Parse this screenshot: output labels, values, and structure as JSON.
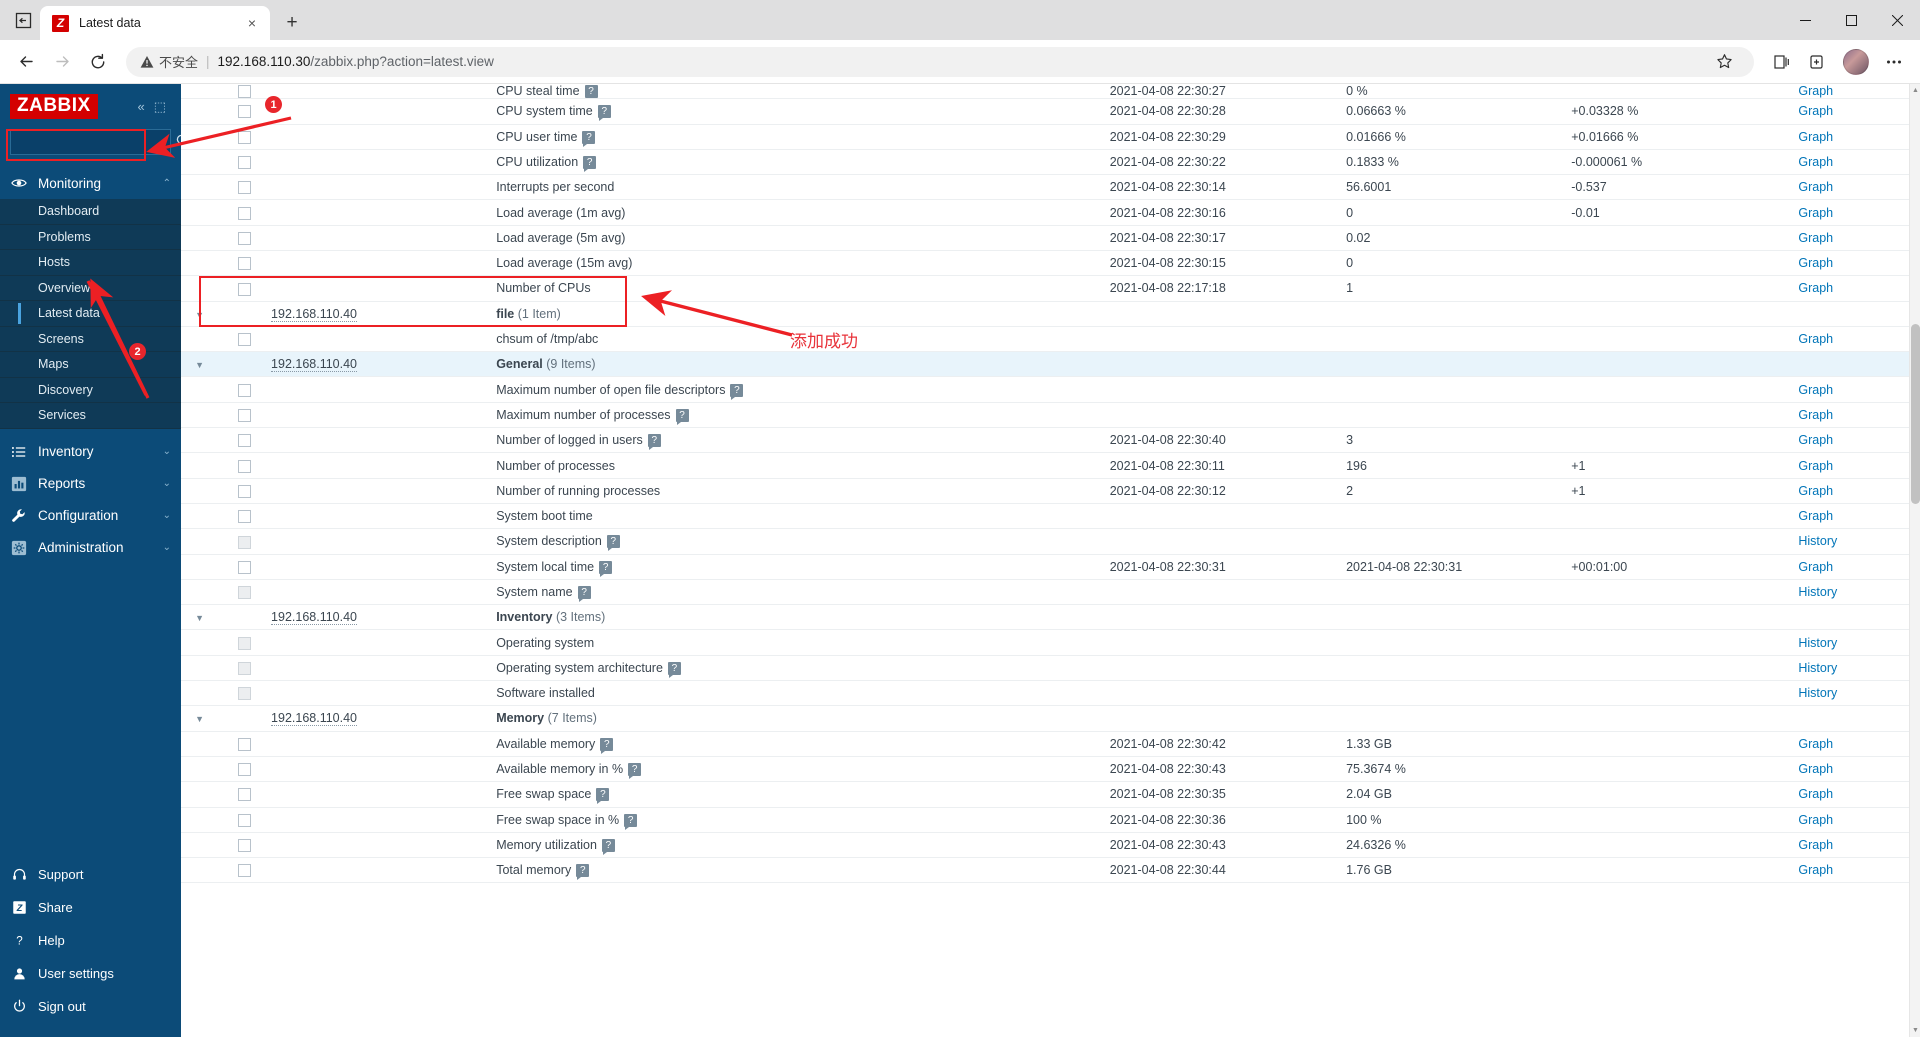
{
  "browser": {
    "tab": {
      "title": "Latest data",
      "favicon_letter": "Z",
      "close_label": "×"
    },
    "new_tab_label": "+",
    "window_controls": {
      "minimize": "─",
      "maximize": "⬜",
      "close": "✕"
    },
    "nav": {
      "back": "←",
      "forward": "→",
      "reload": "⟳"
    },
    "omnibox": {
      "warning_icon": "warning-triangle-icon",
      "security_label": "不安全",
      "separator": "|",
      "url_host": "192.168.110.30",
      "url_path": "/zabbix.php?action=latest.view",
      "full_url": "192.168.110.30/zabbix.php?action=latest.view"
    },
    "toolbar_icons": [
      "favorite-star-icon",
      "collections-icon",
      "browser-essentials-icon",
      "profile-avatar",
      "settings-more-icon"
    ]
  },
  "sidebar": {
    "logo": "ZABBIX",
    "collapse_icon": "«",
    "hide_icon": "⬚",
    "search": {
      "value": "",
      "placeholder": ""
    },
    "sections": [
      {
        "label": "Monitoring",
        "icon": "eye-icon",
        "expanded": true,
        "chevron": "⌃",
        "items": [
          {
            "label": "Dashboard",
            "selected": false
          },
          {
            "label": "Problems",
            "selected": false
          },
          {
            "label": "Hosts",
            "selected": false
          },
          {
            "label": "Overview",
            "selected": false
          },
          {
            "label": "Latest data",
            "selected": true
          },
          {
            "label": "Screens",
            "selected": false
          },
          {
            "label": "Maps",
            "selected": false
          },
          {
            "label": "Discovery",
            "selected": false
          },
          {
            "label": "Services",
            "selected": false
          }
        ]
      },
      {
        "label": "Inventory",
        "icon": "list-icon",
        "expanded": false,
        "chevron": "⌄",
        "items": []
      },
      {
        "label": "Reports",
        "icon": "bar-chart-icon",
        "expanded": false,
        "chevron": "⌄",
        "items": []
      },
      {
        "label": "Configuration",
        "icon": "wrench-icon",
        "expanded": false,
        "chevron": "⌄",
        "items": []
      },
      {
        "label": "Administration",
        "icon": "gear-icon",
        "expanded": false,
        "chevron": "⌄",
        "items": []
      }
    ],
    "bottom": [
      {
        "label": "Support",
        "icon": "headset-icon"
      },
      {
        "label": "Share",
        "icon": "zabbix-share-icon"
      },
      {
        "label": "Help",
        "icon": "question-icon"
      },
      {
        "label": "User settings",
        "icon": "user-icon"
      },
      {
        "label": "Sign out",
        "icon": "power-icon"
      }
    ]
  },
  "table": {
    "graph_label": "Graph",
    "history_label": "History",
    "rows": [
      {
        "kind": "item",
        "name": "CPU steal time",
        "info": true,
        "time": "2021-04-08 22:30:27",
        "value": "0 %",
        "change": "",
        "link": "Graph",
        "clipped": true
      },
      {
        "kind": "item",
        "name": "CPU system time",
        "info": true,
        "time": "2021-04-08 22:30:28",
        "value": "0.06663 %",
        "change": "+0.03328 %",
        "link": "Graph"
      },
      {
        "kind": "item",
        "name": "CPU user time",
        "info": true,
        "time": "2021-04-08 22:30:29",
        "value": "0.01666 %",
        "change": "+0.01666 %",
        "link": "Graph"
      },
      {
        "kind": "item",
        "name": "CPU utilization",
        "info": true,
        "time": "2021-04-08 22:30:22",
        "value": "0.1833 %",
        "change": "-0.000061 %",
        "link": "Graph"
      },
      {
        "kind": "item",
        "name": "Interrupts per second",
        "info": false,
        "time": "2021-04-08 22:30:14",
        "value": "56.6001",
        "change": "-0.537",
        "link": "Graph"
      },
      {
        "kind": "item",
        "name": "Load average (1m avg)",
        "info": false,
        "time": "2021-04-08 22:30:16",
        "value": "0",
        "change": "-0.01",
        "link": "Graph"
      },
      {
        "kind": "item",
        "name": "Load average (5m avg)",
        "info": false,
        "time": "2021-04-08 22:30:17",
        "value": "0.02",
        "change": "",
        "link": "Graph"
      },
      {
        "kind": "item",
        "name": "Load average (15m avg)",
        "info": false,
        "time": "2021-04-08 22:30:15",
        "value": "0",
        "change": "",
        "link": "Graph"
      },
      {
        "kind": "item",
        "name": "Number of CPUs",
        "info": false,
        "time": "2021-04-08 22:17:18",
        "value": "1",
        "change": "",
        "link": "Graph"
      },
      {
        "kind": "group",
        "host": "192.168.110.40",
        "group": "file",
        "count": "(1 Item)",
        "highlight": false
      },
      {
        "kind": "item",
        "name": "chsum of /tmp/abc",
        "info": false,
        "time": "",
        "value": "",
        "change": "",
        "link": "Graph"
      },
      {
        "kind": "group",
        "host": "192.168.110.40",
        "group": "General",
        "count": "(9 Items)",
        "highlight": true
      },
      {
        "kind": "item",
        "name": "Maximum number of open file descriptors",
        "info": true,
        "time": "",
        "value": "",
        "change": "",
        "link": "Graph"
      },
      {
        "kind": "item",
        "name": "Maximum number of processes",
        "info": true,
        "time": "",
        "value": "",
        "change": "",
        "link": "Graph"
      },
      {
        "kind": "item",
        "name": "Number of logged in users",
        "info": true,
        "time": "2021-04-08 22:30:40",
        "value": "3",
        "change": "",
        "link": "Graph"
      },
      {
        "kind": "item",
        "name": "Number of processes",
        "info": false,
        "time": "2021-04-08 22:30:11",
        "value": "196",
        "change": "+1",
        "link": "Graph"
      },
      {
        "kind": "item",
        "name": "Number of running processes",
        "info": false,
        "time": "2021-04-08 22:30:12",
        "value": "2",
        "change": "+1",
        "link": "Graph"
      },
      {
        "kind": "item",
        "name": "System boot time",
        "info": false,
        "time": "",
        "value": "",
        "change": "",
        "link": "Graph"
      },
      {
        "kind": "item",
        "name": "System description",
        "info": true,
        "dim": true,
        "time": "",
        "value": "",
        "change": "",
        "link": "History"
      },
      {
        "kind": "item",
        "name": "System local time",
        "info": true,
        "time": "2021-04-08 22:30:31",
        "value": "2021-04-08 22:30:31",
        "change": "+00:01:00",
        "link": "Graph"
      },
      {
        "kind": "item",
        "name": "System name",
        "info": true,
        "dim": true,
        "time": "",
        "value": "",
        "change": "",
        "link": "History"
      },
      {
        "kind": "group",
        "host": "192.168.110.40",
        "group": "Inventory",
        "count": "(3 Items)",
        "highlight": false
      },
      {
        "kind": "item",
        "name": "Operating system",
        "info": false,
        "dim": true,
        "time": "",
        "value": "",
        "change": "",
        "link": "History"
      },
      {
        "kind": "item",
        "name": "Operating system architecture",
        "info": true,
        "dim": true,
        "time": "",
        "value": "",
        "change": "",
        "link": "History"
      },
      {
        "kind": "item",
        "name": "Software installed",
        "info": false,
        "dim": true,
        "time": "",
        "value": "",
        "change": "",
        "link": "History"
      },
      {
        "kind": "group",
        "host": "192.168.110.40",
        "group": "Memory",
        "count": "(7 Items)",
        "highlight": false
      },
      {
        "kind": "item",
        "name": "Available memory",
        "info": true,
        "time": "2021-04-08 22:30:42",
        "value": "1.33 GB",
        "change": "",
        "link": "Graph"
      },
      {
        "kind": "item",
        "name": "Available memory in %",
        "info": true,
        "time": "2021-04-08 22:30:43",
        "value": "75.3674 %",
        "change": "",
        "link": "Graph"
      },
      {
        "kind": "item",
        "name": "Free swap space",
        "info": true,
        "time": "2021-04-08 22:30:35",
        "value": "2.04 GB",
        "change": "",
        "link": "Graph"
      },
      {
        "kind": "item",
        "name": "Free swap space in %",
        "info": true,
        "time": "2021-04-08 22:30:36",
        "value": "100 %",
        "change": "",
        "link": "Graph"
      },
      {
        "kind": "item",
        "name": "Memory utilization",
        "info": true,
        "time": "2021-04-08 22:30:43",
        "value": "24.6326 %",
        "change": "",
        "link": "Graph"
      },
      {
        "kind": "item",
        "name": "Total memory",
        "info": true,
        "time": "2021-04-08 22:30:44",
        "value": "1.76 GB",
        "change": "",
        "link": "Graph",
        "clipped": true
      }
    ]
  },
  "annotations": {
    "badge_1": "1",
    "badge_2": "2",
    "note_cn": "添加成功",
    "accent_color": "#ec2024"
  },
  "scrollbar": {
    "up_arrow": "▲",
    "down_arrow": "▼"
  }
}
